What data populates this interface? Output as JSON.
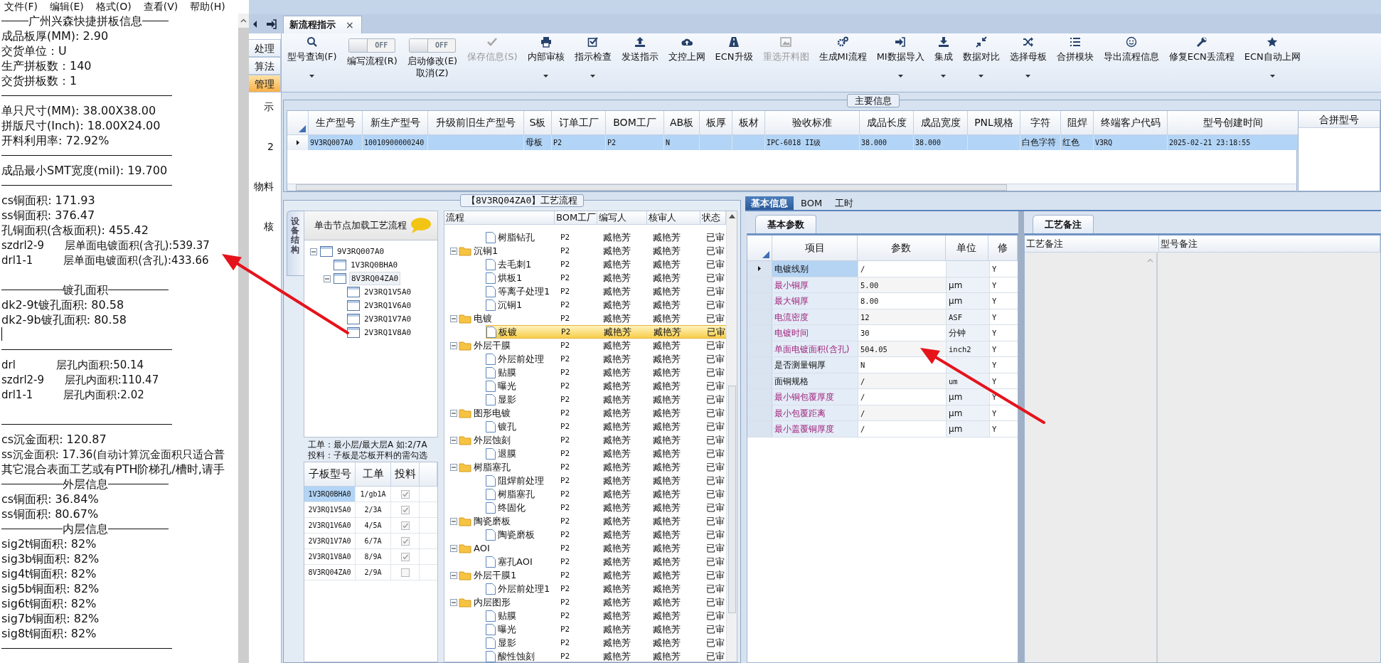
{
  "notepad": {
    "menu": [
      "文件(F)",
      "编辑(E)",
      "格式(O)",
      "查看(V)",
      "帮助(H)"
    ],
    "lines": [
      {
        "kind": "heading",
        "text": "广州兴森快捷拼板信息"
      },
      {
        "kind": "text",
        "text": "成品板厚(MM): 2.90"
      },
      {
        "kind": "text",
        "text": "交货单位：U"
      },
      {
        "kind": "text",
        "text": "生产拼板数：140"
      },
      {
        "kind": "text",
        "text": "交货拼板数：1"
      },
      {
        "kind": "rule"
      },
      {
        "kind": "text",
        "text": "单只尺寸(MM): 38.00X38.00"
      },
      {
        "kind": "text",
        "text": "拼版尺寸(Inch): 18.00X24.00"
      },
      {
        "kind": "text",
        "text": "开料利用率: 72.92%"
      },
      {
        "kind": "rule"
      },
      {
        "kind": "text",
        "text": "成品最小SMT宽度(mil): 19.700"
      },
      {
        "kind": "rule"
      },
      {
        "kind": "text",
        "text": "cs铜面积: 171.93"
      },
      {
        "kind": "text",
        "text": "ss铜面积: 376.47"
      },
      {
        "kind": "text",
        "text": "孔铜面积(含板面积): 455.42"
      },
      {
        "kind": "text",
        "text": "szdrl2-9      层单面电镀面积(含孔):539.37"
      },
      {
        "kind": "text",
        "text": "drl1-1         层单面电镀面积(含孔):433.66"
      },
      {
        "kind": "blank"
      },
      {
        "kind": "heading",
        "text": "镀孔面积"
      },
      {
        "kind": "text",
        "text": "dk2-9t镀孔面积: 80.58"
      },
      {
        "kind": "text",
        "text": "dk2-9b镀孔面积: 80.58"
      },
      {
        "kind": "cursor"
      },
      {
        "kind": "rule"
      },
      {
        "kind": "text",
        "text": "drl            层孔内面积:50.14"
      },
      {
        "kind": "text",
        "text": "szdrl2-9      层孔内面积:110.47"
      },
      {
        "kind": "text",
        "text": "drl1-1         层孔内面积:2.02"
      },
      {
        "kind": "blank"
      },
      {
        "kind": "rule"
      },
      {
        "kind": "text",
        "text": "cs沉金面积: 120.87"
      },
      {
        "kind": "text",
        "text": "ss沉金面积: 17.36(自动计算沉金面积只适合普"
      },
      {
        "kind": "text",
        "text": "其它混合表面工艺或有PTH阶梯孔/槽时,请手"
      },
      {
        "kind": "heading",
        "text": "外层信息"
      },
      {
        "kind": "text",
        "text": "cs铜面积: 36.84%"
      },
      {
        "kind": "text",
        "text": "ss铜面积: 80.67%"
      },
      {
        "kind": "heading",
        "text": "内层信息"
      },
      {
        "kind": "text",
        "text": "sig2t铜面积: 82%"
      },
      {
        "kind": "text",
        "text": "sig3b铜面积: 82%"
      },
      {
        "kind": "text",
        "text": "sig4t铜面积: 82%"
      },
      {
        "kind": "text",
        "text": "sig5b铜面积: 82%"
      },
      {
        "kind": "text",
        "text": "sig6t铜面积: 82%"
      },
      {
        "kind": "text",
        "text": "sig7b铜面积: 82%"
      },
      {
        "kind": "text",
        "text": "sig8t铜面积: 82%"
      },
      {
        "kind": "rule"
      }
    ]
  },
  "side_nav": [
    {
      "kind": "button",
      "label": "处理",
      "selected": false
    },
    {
      "kind": "button",
      "label": "算法",
      "selected": false
    },
    {
      "kind": "button",
      "label": "管理",
      "selected": true
    },
    {
      "kind": "text",
      "label": "示",
      "selected": false
    },
    {
      "kind": "text",
      "label": "2",
      "selected": false
    },
    {
      "kind": "text",
      "label": "物料",
      "selected": false
    },
    {
      "kind": "text",
      "label": "核",
      "selected": false
    }
  ],
  "doc_tabs": [
    {
      "label": "新流程指示",
      "close": "×",
      "selected": true
    }
  ],
  "toolbar": [
    {
      "kind": "button",
      "label": "型号查询(F)",
      "dropdown": true,
      "disabled": false
    },
    {
      "kind": "toggle",
      "switch_text": "OFF",
      "on": false,
      "label": "编写流程(R)"
    },
    {
      "kind": "toggle",
      "switch_text": "OFF",
      "on": false,
      "label": "启动修改(E)",
      "label2": "取消(Z)"
    },
    {
      "kind": "button",
      "label": "保存信息(S)",
      "dropdown": false,
      "disabled": true
    },
    {
      "kind": "button",
      "label": "内部审核",
      "dropdown": true,
      "disabled": false
    },
    {
      "kind": "button",
      "label": "指示检查",
      "dropdown": true,
      "disabled": false
    },
    {
      "kind": "button",
      "label": "发送指示",
      "dropdown": false,
      "disabled": false
    },
    {
      "kind": "button",
      "label": "文控上网",
      "dropdown": false,
      "disabled": false
    },
    {
      "kind": "button",
      "label": "ECN升级",
      "dropdown": false,
      "disabled": false
    },
    {
      "kind": "button",
      "label": "重选开料图",
      "dropdown": false,
      "disabled": true
    },
    {
      "kind": "button",
      "label": "生成MI流程",
      "dropdown": false,
      "disabled": false
    },
    {
      "kind": "button",
      "label": "MI数据导入",
      "dropdown": true,
      "disabled": false
    },
    {
      "kind": "button",
      "label": "集成",
      "dropdown": true,
      "disabled": false
    },
    {
      "kind": "button",
      "label": "数据对比",
      "dropdown": true,
      "disabled": false
    },
    {
      "kind": "button",
      "label": "选择母板",
      "dropdown": true,
      "disabled": false
    },
    {
      "kind": "button",
      "label": "合拼模块",
      "dropdown": false,
      "disabled": false
    },
    {
      "kind": "button",
      "label": "导出流程信息",
      "dropdown": false,
      "disabled": false
    },
    {
      "kind": "button",
      "label": "修复ECN丢流程",
      "dropdown": false,
      "disabled": false
    },
    {
      "kind": "button",
      "label": "ECN自动上网",
      "dropdown": true,
      "disabled": false
    }
  ],
  "main_info": {
    "title": "主要信息",
    "columns": [
      "生产型号",
      "新生产型号",
      "升级前旧生产型号",
      "S板",
      "订单工厂",
      "BOM工厂",
      "AB板",
      "板厚",
      "板材",
      "验收标准",
      "成品长度",
      "成品宽度",
      "PNL规格",
      "字符",
      "阻焊",
      "终端客户代码",
      "型号创建时间"
    ],
    "rows": [
      {
        "selected": true,
        "cells": [
          "9V3RQ007A0",
          "10010900000240",
          null,
          "母板",
          "P2",
          "P2",
          "N",
          null,
          null,
          "IPC-6018 II级",
          "38.000",
          "38.000",
          null,
          "白色字符",
          "红色",
          "V3RQ",
          "2025-02-21 23:18:55"
        ]
      }
    ]
  },
  "merge_panel": {
    "title": "合拼型号"
  },
  "process": {
    "title": "【8V3RQ04ZA0】工艺流程",
    "side_tab": "设备结构",
    "tree_header": "单击节点加载工艺流程",
    "tree": [
      {
        "label": "9V3RQ007A0",
        "selected": false,
        "expanded": true,
        "children": [
          {
            "label": "1V3RQ0BHA0",
            "selected": false
          },
          {
            "label": "8V3RQ04ZA0",
            "selected": true,
            "expanded": true,
            "children": [
              {
                "label": "2V3RQ1V5A0",
                "selected": false
              },
              {
                "label": "2V3RQ1V6A0",
                "selected": false
              },
              {
                "label": "2V3RQ1V7A0",
                "selected": false
              },
              {
                "label": "2V3RQ1V8A0",
                "selected": false
              }
            ]
          }
        ]
      }
    ],
    "notes": [
      "工单：最小层/最大层A 如:2/7A",
      "投料：子板是芯板开料的需勾选"
    ],
    "sub_boards": {
      "columns": [
        "子板型号",
        "工单",
        "投料"
      ],
      "rows": [
        {
          "model": "1V3RQ0BHA0",
          "order": "1/gb1A",
          "feed": true,
          "selected": true
        },
        {
          "model": "2V3RQ1V5A0",
          "order": "2/3A",
          "feed": true,
          "selected": false
        },
        {
          "model": "2V3RQ1V6A0",
          "order": "4/5A",
          "feed": true,
          "selected": false
        },
        {
          "model": "2V3RQ1V7A0",
          "order": "6/7A",
          "feed": true,
          "selected": false
        },
        {
          "model": "2V3RQ1V8A0",
          "order": "8/9A",
          "feed": true,
          "selected": false
        },
        {
          "model": "8V3RQ04ZA0",
          "order": "2/9A",
          "feed": false,
          "selected": false
        }
      ]
    },
    "flow": {
      "columns": [
        "流程",
        "BOM工厂",
        "编写人",
        "核审人",
        "状态"
      ],
      "steps": [
        {
          "kind": "step",
          "label": "树脂钻孔",
          "factory": "P2",
          "writer": "臧艳芳",
          "reviewer": "臧艳芳",
          "status": "已审",
          "selected": false
        },
        {
          "kind": "folder",
          "label": "沉铜1",
          "factory": "P2",
          "writer": "臧艳芳",
          "reviewer": "臧艳芳",
          "status": "已审",
          "selected": false,
          "children": [
            {
              "kind": "step",
              "label": "去毛刺1",
              "factory": "P2",
              "writer": "臧艳芳",
              "reviewer": "臧艳芳",
              "status": "已审",
              "selected": false
            },
            {
              "kind": "step",
              "label": "烘板1",
              "factory": "P2",
              "writer": "臧艳芳",
              "reviewer": "臧艳芳",
              "status": "已审",
              "selected": false
            },
            {
              "kind": "step",
              "label": "等离子处理1",
              "factory": "P2",
              "writer": "臧艳芳",
              "reviewer": "臧艳芳",
              "status": "已审",
              "selected": false
            },
            {
              "kind": "step",
              "label": "沉铜1",
              "factory": "P2",
              "writer": "臧艳芳",
              "reviewer": "臧艳芳",
              "status": "已审",
              "selected": false
            }
          ]
        },
        {
          "kind": "folder",
          "label": "电镀",
          "factory": "P2",
          "writer": "臧艳芳",
          "reviewer": "臧艳芳",
          "status": "已审",
          "selected": false,
          "children": [
            {
              "kind": "step",
              "label": "板镀",
              "factory": "P2",
              "writer": "臧艳芳",
              "reviewer": "臧艳芳",
              "status": "已审",
              "selected": true
            }
          ]
        },
        {
          "kind": "folder",
          "label": "外层干膜",
          "factory": "P2",
          "writer": "臧艳芳",
          "reviewer": "臧艳芳",
          "status": "已审",
          "selected": false,
          "children": [
            {
              "kind": "step",
              "label": "外层前处理",
              "factory": "P2",
              "writer": "臧艳芳",
              "reviewer": "臧艳芳",
              "status": "已审",
              "selected": false
            },
            {
              "kind": "step",
              "label": "贴膜",
              "factory": "P2",
              "writer": "臧艳芳",
              "reviewer": "臧艳芳",
              "status": "已审",
              "selected": false
            },
            {
              "kind": "step",
              "label": "曝光",
              "factory": "P2",
              "writer": "臧艳芳",
              "reviewer": "臧艳芳",
              "status": "已审",
              "selected": false
            },
            {
              "kind": "step",
              "label": "显影",
              "factory": "P2",
              "writer": "臧艳芳",
              "reviewer": "臧艳芳",
              "status": "已审",
              "selected": false
            }
          ]
        },
        {
          "kind": "folder",
          "label": "图形电镀",
          "factory": "P2",
          "writer": "臧艳芳",
          "reviewer": "臧艳芳",
          "status": "已审",
          "selected": false,
          "children": [
            {
              "kind": "step",
              "label": "镀孔",
              "factory": "P2",
              "writer": "臧艳芳",
              "reviewer": "臧艳芳",
              "status": "已审",
              "selected": false
            }
          ]
        },
        {
          "kind": "folder",
          "label": "外层蚀刻",
          "factory": "P2",
          "writer": "臧艳芳",
          "reviewer": "臧艳芳",
          "status": "已审",
          "selected": false,
          "children": [
            {
              "kind": "step",
              "label": "退膜",
              "factory": "P2",
              "writer": "臧艳芳",
              "reviewer": "臧艳芳",
              "status": "已审",
              "selected": false
            }
          ]
        },
        {
          "kind": "folder",
          "label": "树脂塞孔",
          "factory": "P2",
          "writer": "臧艳芳",
          "reviewer": "臧艳芳",
          "status": "已审",
          "selected": false,
          "children": [
            {
              "kind": "step",
              "label": "阻焊前处理",
              "factory": "P2",
              "writer": "臧艳芳",
              "reviewer": "臧艳芳",
              "status": "已审",
              "selected": false
            },
            {
              "kind": "step",
              "label": "树脂塞孔",
              "factory": "P2",
              "writer": "臧艳芳",
              "reviewer": "臧艳芳",
              "status": "已审",
              "selected": false
            },
            {
              "kind": "step",
              "label": "终固化",
              "factory": "P2",
              "writer": "臧艳芳",
              "reviewer": "臧艳芳",
              "status": "已审",
              "selected": false
            }
          ]
        },
        {
          "kind": "folder",
          "label": "陶瓷磨板",
          "factory": "P2",
          "writer": "臧艳芳",
          "reviewer": "臧艳芳",
          "status": "已审",
          "selected": false,
          "children": [
            {
              "kind": "step",
              "label": "陶瓷磨板",
              "factory": "P2",
              "writer": "臧艳芳",
              "reviewer": "臧艳芳",
              "status": "已审",
              "selected": false
            }
          ]
        },
        {
          "kind": "folder",
          "label": "AOI",
          "factory": "P2",
          "writer": "臧艳芳",
          "reviewer": "臧艳芳",
          "status": "已审",
          "selected": false,
          "children": [
            {
              "kind": "step",
              "label": "塞孔AOI",
              "factory": "P2",
              "writer": "臧艳芳",
              "reviewer": "臧艳芳",
              "status": "已审",
              "selected": false
            }
          ]
        },
        {
          "kind": "folder",
          "label": "外层干膜1",
          "factory": "P2",
          "writer": "臧艳芳",
          "reviewer": "臧艳芳",
          "status": "已审",
          "selected": false,
          "children": [
            {
              "kind": "step",
              "label": "外层前处理1",
              "factory": "P2",
              "writer": "臧艳芳",
              "reviewer": "臧艳芳",
              "status": "已审",
              "selected": false
            }
          ]
        },
        {
          "kind": "folder",
          "label": "内层图形",
          "factory": "P2",
          "writer": "臧艳芳",
          "reviewer": "臧艳芳",
          "status": "已审",
          "selected": false,
          "children": [
            {
              "kind": "step",
              "label": "贴膜",
              "factory": "P2",
              "writer": "臧艳芳",
              "reviewer": "臧艳芳",
              "status": "已审",
              "selected": false
            },
            {
              "kind": "step",
              "label": "曝光",
              "factory": "P2",
              "writer": "臧艳芳",
              "reviewer": "臧艳芳",
              "status": "已审",
              "selected": false
            },
            {
              "kind": "step",
              "label": "显影",
              "factory": "P2",
              "writer": "臧艳芳",
              "reviewer": "臧艳芳",
              "status": "已审",
              "selected": false
            },
            {
              "kind": "step",
              "label": "酸性蚀刻",
              "factory": "P2",
              "writer": "臧艳芳",
              "reviewer": "臧艳芳",
              "status": "已审",
              "selected": false
            }
          ]
        }
      ]
    }
  },
  "details": {
    "tabs": [
      {
        "label": "基本信息",
        "selected": true
      },
      {
        "label": "BOM",
        "selected": false
      },
      {
        "label": "工时",
        "selected": false
      }
    ],
    "params": {
      "title": "基本参数",
      "columns": [
        "项目",
        "参数",
        "单位",
        "修"
      ],
      "rows": [
        {
          "item": "电镀线别",
          "value": "/",
          "unit": null,
          "modify": "Y",
          "emphasized": false,
          "selected": true
        },
        {
          "item": "最小铜厚",
          "value": "5.00",
          "unit": "μm",
          "modify": "Y",
          "emphasized": true,
          "selected": false
        },
        {
          "item": "最大铜厚",
          "value": "8.00",
          "unit": "μm",
          "modify": "Y",
          "emphasized": true,
          "selected": false
        },
        {
          "item": "电流密度",
          "value": "12",
          "unit": "ASF",
          "modify": "Y",
          "emphasized": true,
          "selected": false
        },
        {
          "item": "电镀时间",
          "value": "30",
          "unit": "分钟",
          "modify": "Y",
          "emphasized": true,
          "selected": false
        },
        {
          "item": "单面电镀面积(含孔)",
          "value": "504.05",
          "unit": "inch2",
          "modify": "Y",
          "emphasized": true,
          "selected": false
        },
        {
          "item": "是否测量铜厚",
          "value": "N",
          "unit": null,
          "modify": "Y",
          "emphasized": false,
          "selected": false
        },
        {
          "item": "面铜规格",
          "value": "/",
          "unit": "um",
          "modify": "Y",
          "emphasized": false,
          "selected": false
        },
        {
          "item": "最小铜包覆厚度",
          "value": "/",
          "unit": "μm",
          "modify": "Y",
          "emphasized": true,
          "selected": false
        },
        {
          "item": "最小包覆距离",
          "value": "/",
          "unit": "μm",
          "modify": "Y",
          "emphasized": true,
          "selected": false
        },
        {
          "item": "最小盖覆铜厚度",
          "value": "/",
          "unit": "μm",
          "modify": "Y",
          "emphasized": true,
          "selected": false
        }
      ]
    },
    "remarks": {
      "title": "工艺备注",
      "columns": [
        "工艺备注",
        "型号备注"
      ]
    }
  }
}
